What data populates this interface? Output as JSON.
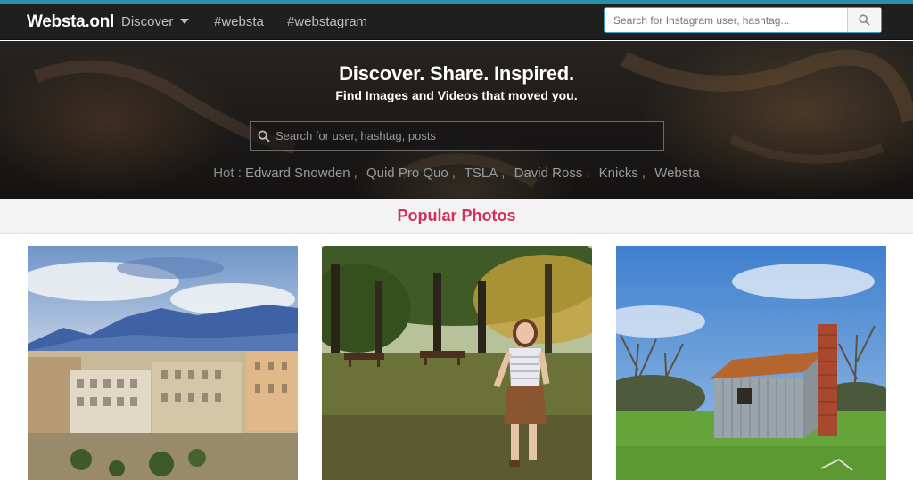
{
  "navbar": {
    "brand": "Websta.onl",
    "items": [
      {
        "label": "Discover",
        "has_dropdown": true
      },
      {
        "label": "#websta"
      },
      {
        "label": "#webstagram"
      }
    ],
    "search": {
      "placeholder": "Search for Instagram user, hashtag..."
    }
  },
  "hero": {
    "title": "Discover. Share. Inspired.",
    "subtitle": "Find Images and Videos that moved you.",
    "search_placeholder": "Search for user, hashtag, posts",
    "hot_label": "Hot :",
    "hot_items": [
      "Edward Snowden",
      "Quid Pro Quo",
      "TSLA",
      "David Ross",
      "Knicks",
      "Websta"
    ]
  },
  "section": {
    "title": "Popular Photos"
  },
  "photos": [
    {
      "icon": "city-photo"
    },
    {
      "icon": "park-photo"
    },
    {
      "icon": "hut-photo"
    }
  ],
  "colors": {
    "accent": "#d2305a",
    "topstrip": "#2a8dac",
    "navbar": "#1f1f1f"
  }
}
